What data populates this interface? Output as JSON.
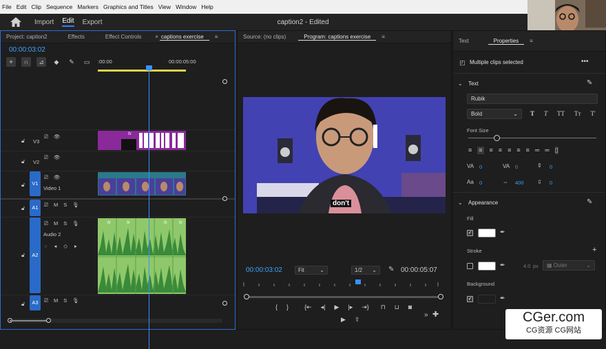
{
  "menu": [
    "File",
    "Edit",
    "Clip",
    "Sequence",
    "Markers",
    "Graphics and Titles",
    "View",
    "Window",
    "Help"
  ],
  "workspaces": [
    "Import",
    "Edit",
    "Export"
  ],
  "document_title": "caption2 - Edited",
  "timeline_panel": {
    "tabs": [
      "Project: caption2",
      "Effects",
      "Effect Controls",
      "captions exercise"
    ],
    "timecode": "00:00:03:02",
    "ruler": [
      ":00:00",
      "00:00:05:00"
    ],
    "tracks": {
      "v3": "V3",
      "v2": "V2",
      "v1": "V1",
      "v1_name": "Video 1",
      "a1": "A1",
      "a2": "A2",
      "a2_name": "Audio 2",
      "a3": "A3",
      "m": "M",
      "s": "S"
    },
    "fx": "fx"
  },
  "program_panel": {
    "tabs": [
      "Source: (no clips)",
      "Program: captions exercise"
    ],
    "caption": "don't",
    "timecode": "00:00:03:02",
    "fit": "Fit",
    "resolution": "1/2",
    "duration": "00:00:05:07"
  },
  "properties_panel": {
    "tabs": [
      "Text",
      "Properties"
    ],
    "selection": "Multiple clips selected",
    "text_section": "Text",
    "font": "Rubik",
    "style": "Bold",
    "style_buttons": [
      "T",
      "T",
      "TT",
      "Tт",
      "T'"
    ],
    "font_size_label": "Font Size",
    "font_size_level": 0.22,
    "metrics": [
      "0",
      "0",
      "0",
      "0",
      "400",
      "0"
    ],
    "appearance_section": "Appearance",
    "fill_label": "Fill",
    "stroke_label": "Stroke",
    "stroke_width": "4.0",
    "stroke_unit": "px",
    "stroke_position": "Outer",
    "background_label": "Background",
    "fill_color": "#ffffff",
    "stroke_color": "#ffffff",
    "background_color": "#1e1e1e",
    "fill_checked": true,
    "stroke_checked": false,
    "background_checked": true
  },
  "colors": {
    "accent": "#2b80ff",
    "timecode": "#3ea0ff",
    "graphics_clip": "#8a2a9a",
    "video_clip": "#2a7a8a",
    "audio_clip": "#7fc055"
  },
  "watermark": {
    "brand": "CGer.com",
    "sub": "CG资源 CG网站"
  }
}
